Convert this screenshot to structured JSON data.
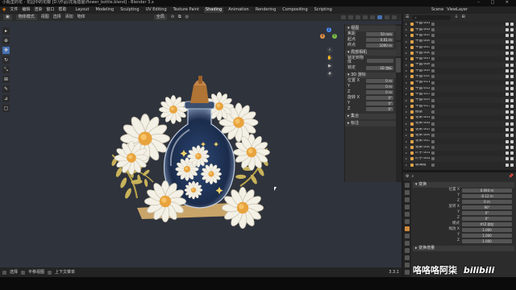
{
  "window": {
    "title": "小瓶里的花 - 花园中的花瓣 [D:\\作品\\花瓶插画\\flower_bottle.blend] - Blender 3.x",
    "controls": [
      "–",
      "□",
      "✕"
    ]
  },
  "menubar": {
    "menus": [
      "文件",
      "编辑",
      "渲染",
      "窗口",
      "帮助"
    ],
    "tabs": [
      {
        "label": "Layout",
        "active": false
      },
      {
        "label": "Modeling",
        "active": false
      },
      {
        "label": "Sculpting",
        "active": false
      },
      {
        "label": "UV Editing",
        "active": false
      },
      {
        "label": "Texture Paint",
        "active": false
      },
      {
        "label": "Shading",
        "active": true
      },
      {
        "label": "Animation",
        "active": false
      },
      {
        "label": "Rendering",
        "active": false
      },
      {
        "label": "Compositing",
        "active": false
      },
      {
        "label": "Scripting",
        "active": false
      }
    ],
    "scene_label": "Scene",
    "viewlayer_label": "ViewLayer"
  },
  "viewport_header": {
    "mode": "物体模式",
    "menus": [
      "视图",
      "选择",
      "添加",
      "物体"
    ],
    "orientation": "全局",
    "snap": "",
    "proportional": ""
  },
  "toolbar": {
    "tools": [
      {
        "icon": "select-box-icon",
        "glyph": "▸",
        "active": false
      },
      {
        "icon": "cursor-icon",
        "glyph": "⊕",
        "active": false
      },
      {
        "icon": "move-icon",
        "glyph": "✥",
        "active": true
      },
      {
        "icon": "rotate-icon",
        "glyph": "↻",
        "active": false
      },
      {
        "icon": "scale-icon",
        "glyph": "⤡",
        "active": false
      },
      {
        "icon": "transform-icon",
        "glyph": "⊞",
        "active": false
      },
      {
        "icon": "annotate-icon",
        "glyph": "✎",
        "active": false
      },
      {
        "icon": "measure-icon",
        "glyph": "⊿",
        "active": false
      },
      {
        "icon": "add-cube-icon",
        "glyph": "▢",
        "active": false
      }
    ]
  },
  "nav_gizmo": {
    "axes": [
      {
        "label": "Z",
        "color": "#4b8df0"
      },
      {
        "label": "X",
        "color": "#e5944a"
      },
      {
        "label": "Y",
        "color": "#7ec04b"
      }
    ],
    "buttons": [
      "zoom-icon",
      "pan-icon",
      "camera-icon",
      "grid-icon"
    ]
  },
  "npanel": {
    "sections": [
      {
        "title": "▾ 视图",
        "rows": [
          {
            "label": "焦距",
            "value": "50 mm"
          },
          {
            "label": "起点",
            "value": "0.01 m"
          },
          {
            "label": "终点",
            "value": "1000 m"
          }
        ]
      },
      {
        "title": "▾ 局部相机",
        "rows": [
          {
            "label": "锁定到物体",
            "value": ""
          },
          {
            "label": "锁定",
            "value": "3D 游标"
          }
        ]
      },
      {
        "title": "▾ 3D 游标",
        "rows": [
          {
            "label": "位置 X",
            "value": "0 m"
          },
          {
            "label": "Y",
            "value": "0 m"
          },
          {
            "label": "Z",
            "value": "0 m"
          },
          {
            "label": "旋转 X",
            "value": "0°"
          },
          {
            "label": "Y",
            "value": "0°"
          },
          {
            "label": "Z",
            "value": "0°"
          }
        ]
      },
      {
        "title": "▸ 集合",
        "rows": []
      },
      {
        "title": "▸ 标注",
        "rows": []
      }
    ],
    "tab_icons": [
      "item-tab",
      "tool-tab",
      "view-tab"
    ]
  },
  "statusbar": {
    "items": [
      "选择",
      "平移视图",
      "上下文菜单"
    ],
    "version": "3.3.1"
  },
  "outliner": {
    "search_placeholder": "",
    "rows": [
      {
        "label": "平面.001",
        "icon_color": "#e0a34a"
      },
      {
        "label": "平面.002",
        "icon_color": "#e0a34a"
      },
      {
        "label": "平面.003",
        "icon_color": "#e0a34a"
      },
      {
        "label": "平面.004",
        "icon_color": "#e0a34a"
      },
      {
        "label": "平面.005",
        "icon_color": "#e0a34a"
      },
      {
        "label": "平面.006",
        "icon_color": "#e0a34a"
      },
      {
        "label": "平面.007",
        "icon_color": "#e0a34a"
      },
      {
        "label": "平面.008",
        "icon_color": "#e0a34a"
      },
      {
        "label": "平面.009",
        "icon_color": "#e0a34a"
      },
      {
        "label": "平面.010",
        "icon_color": "#e0a34a"
      },
      {
        "label": "平面.011",
        "icon_color": "#e0a34a"
      },
      {
        "label": "平面.012",
        "icon_color": "#e0a34a"
      },
      {
        "label": "平面.013",
        "icon_color": "#e0a34a"
      },
      {
        "label": "平面.014",
        "icon_color": "#e0a34a"
      },
      {
        "label": "平面.015",
        "icon_color": "#e0a34a"
      },
      {
        "label": "瓶塞",
        "icon_color": "#e0a34a"
      },
      {
        "label": "花朵.001",
        "icon_color": "#e0a34a"
      },
      {
        "label": "花朵.002",
        "icon_color": "#e0a34a"
      },
      {
        "label": "花朵.003",
        "icon_color": "#e0a34a"
      },
      {
        "label": "花朵.004",
        "icon_color": "#e0a34a"
      },
      {
        "label": "花朵.005",
        "icon_color": "#e0a34a"
      },
      {
        "label": "花朵.006",
        "icon_color": "#e0a34a"
      },
      {
        "label": "叶子.001",
        "icon_color": "#e0a34a"
      },
      {
        "label": "叶子.002",
        "icon_color": "#e0a34a"
      },
      {
        "label": "玻璃瓶",
        "icon_color": "#e0a34a"
      }
    ]
  },
  "properties": {
    "header_label": "▾ 变换",
    "rows": [
      {
        "label": "位置 X",
        "value": "0.094 m"
      },
      {
        "label": "Y",
        "value": "-0.12 m"
      },
      {
        "label": "Z",
        "value": "0 m"
      },
      {
        "label": "旋转 X",
        "value": "90°"
      },
      {
        "label": "Y",
        "value": "0°"
      },
      {
        "label": "Z",
        "value": "0°"
      },
      {
        "label": "模式",
        "value": "XYZ 欧拉"
      },
      {
        "label": "缩放 X",
        "value": "1.000"
      },
      {
        "label": "Y",
        "value": "1.000"
      },
      {
        "label": "Z",
        "value": "1.000"
      }
    ],
    "tab_icons": [
      "tool-icon",
      "render-icon",
      "output-icon",
      "view-layer-icon",
      "scene-icon",
      "world-icon",
      "object-icon",
      "modifier-icon",
      "particles-icon",
      "physics-icon",
      "constraints-icon",
      "data-icon",
      "material-icon"
    ],
    "active_tab": 6,
    "footer": "▸ 变换增量"
  },
  "watermark": {
    "author": "咯咯咯阿柒",
    "site": "bilibili"
  }
}
